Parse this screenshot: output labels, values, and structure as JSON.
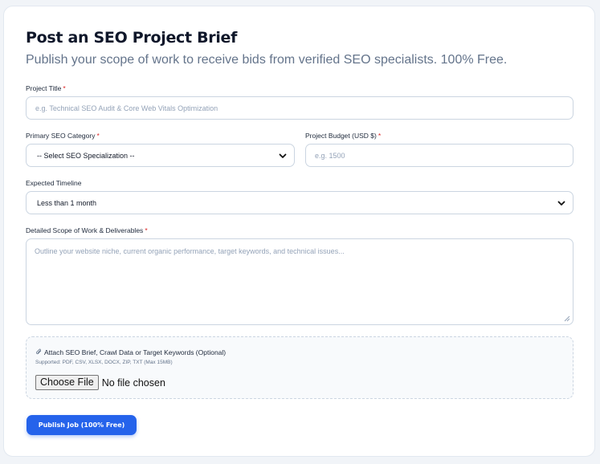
{
  "header": {
    "title": "Post an SEO Project Brief",
    "subtitle": "Publish your scope of work to receive bids from verified SEO specialists. 100% Free."
  },
  "form": {
    "required_mark": "*",
    "project_title": {
      "label": "Project Title",
      "placeholder": "e.g. Technical SEO Audit & Core Web Vitals Optimization",
      "value": ""
    },
    "category": {
      "label": "Primary SEO Category",
      "selected": "-- Select SEO Specialization --"
    },
    "budget": {
      "label": "Project Budget (USD $)",
      "placeholder": "e.g. 1500",
      "value": ""
    },
    "timeline": {
      "label": "Expected Timeline",
      "selected": "Less than 1 month"
    },
    "scope": {
      "label": "Detailed Scope of Work & Deliverables",
      "placeholder": "Outline your website niche, current organic performance, target keywords, and technical issues...",
      "value": ""
    },
    "attachment": {
      "icon": "paperclip-icon",
      "title": "Attach SEO Brief, Crawl Data or Target Keywords (Optional)",
      "supported": "Supported: PDF, CSV, XLSX, DOCX, ZIP, TXT (Max 15MB)",
      "button_label": "Choose File",
      "status": "No file chosen"
    },
    "submit_label": "Publish Job (100% Free)"
  },
  "colors": {
    "accent": "#2563eb",
    "required": "#dc2626",
    "title": "#0f172a",
    "subtitle": "#64748b",
    "border": "#cbd5e1",
    "page_bg": "#f1f4f8"
  }
}
